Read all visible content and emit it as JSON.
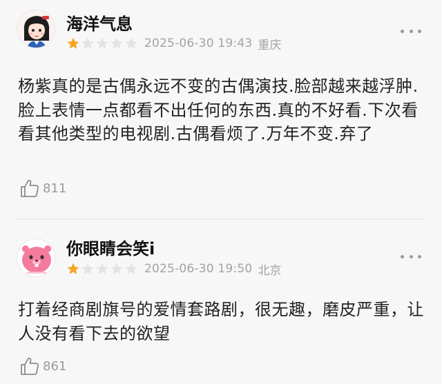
{
  "reviews": [
    {
      "username": "海洋气息",
      "rating": 1,
      "max_rating": 5,
      "date": "2025-06-30 19:43",
      "location": "重庆",
      "text": "杨紫真的是古偶永远不变的古偶演技.脸部越来越浮肿.脸上表情一点都看不出任何的东西.真的不好看.下次看看其他类型的电视剧.古偶看烦了.万年不变.弃了",
      "likes": "811",
      "avatar_icon": "girl-avatar-icon"
    },
    {
      "username": "你眼睛会笑i",
      "rating": 1,
      "max_rating": 5,
      "date": "2025-06-30 19:50",
      "location": "北京",
      "text": "打着经商剧旗号的爱情套路剧，很无趣，磨皮严重，让人没有看下去的欲望",
      "likes": "861",
      "avatar_icon": "pink-beaver-avatar-icon"
    }
  ],
  "colors": {
    "star_filled": "#f5a623",
    "star_empty": "#e3e3e3",
    "meta_text": "#a2a2a2"
  }
}
